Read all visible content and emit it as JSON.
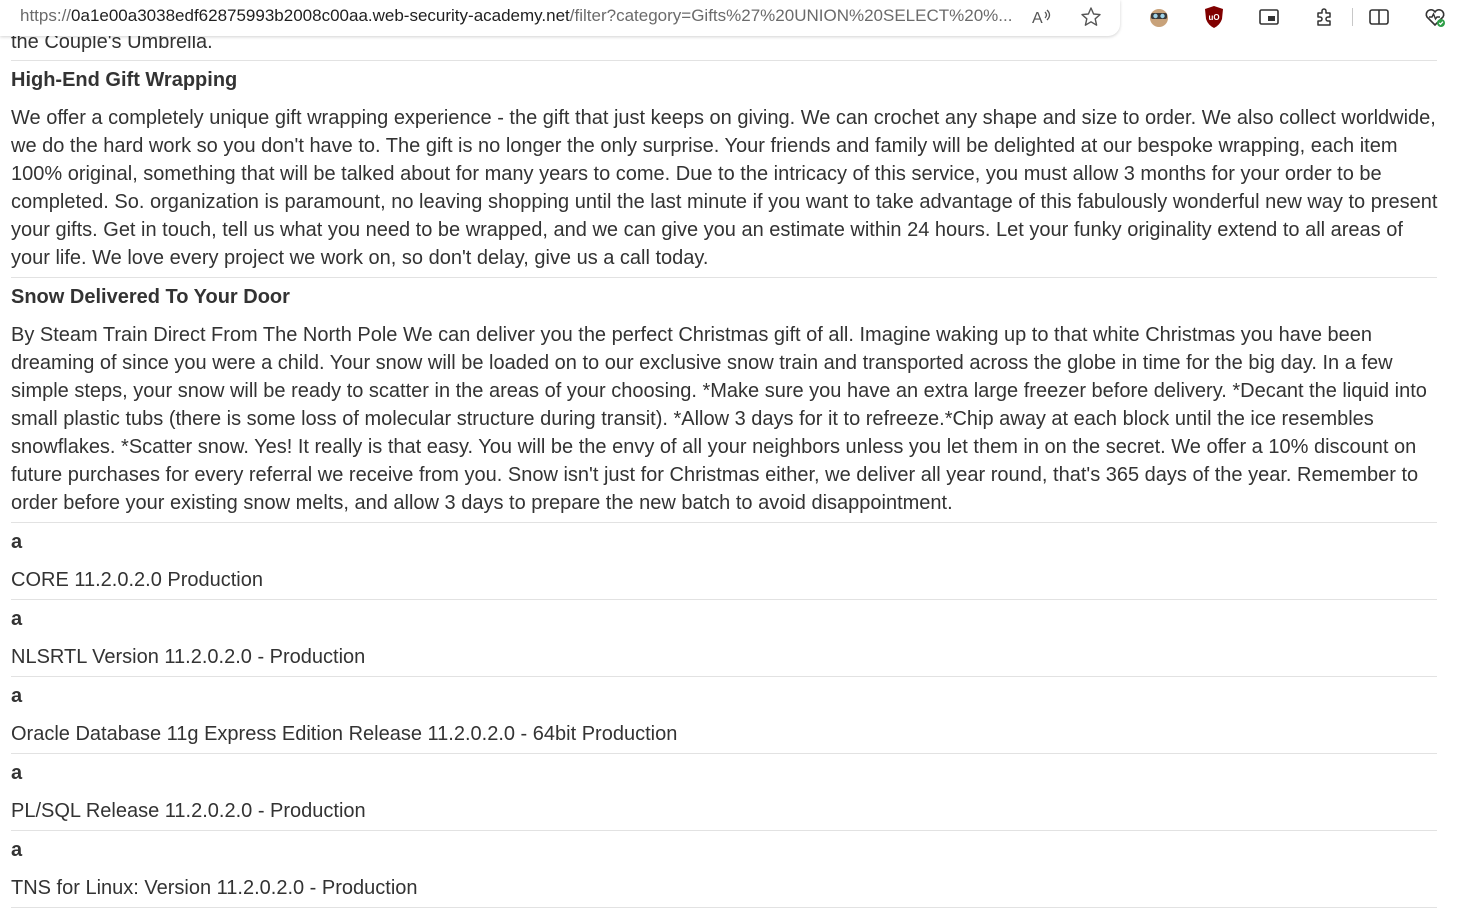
{
  "browser": {
    "url": {
      "prefix": "https://",
      "host": "0a1e00a3038edf62875993b2008c00aa.web-security-academy.net",
      "path": "/filter?category=Gifts%27%20UNION%20SELECT%20%..."
    },
    "icons": [
      "read-aloud-icon",
      "favorite-star-icon",
      "extension-avatar-icon",
      "ublock-icon",
      "picture-in-picture-icon",
      "extensions-puzzle-icon",
      "split-screen-icon",
      "browser-essentials-icon"
    ]
  },
  "page": {
    "clipped_text": "the Couple's Umbrella.",
    "products": [
      {
        "name": "High-End Gift Wrapping",
        "description": "We offer a completely unique gift wrapping experience - the gift that just keeps on giving. We can crochet any shape and size to order. We also collect worldwide, we do the hard work so you don't have to. The gift is no longer the only surprise. Your friends and family will be delighted at our bespoke wrapping, each item 100% original, something that will be talked about for many years to come. Due to the intricacy of this service, you must allow 3 months for your order to be completed. So. organization is paramount, no leaving shopping until the last minute if you want to take advantage of this fabulously wonderful new way to present your gifts. Get in touch, tell us what you need to be wrapped, and we can give you an estimate within 24 hours. Let your funky originality extend to all areas of your life. We love every project we work on, so don't delay, give us a call today."
      },
      {
        "name": "Snow Delivered To Your Door",
        "description": "By Steam Train Direct From The North Pole We can deliver you the perfect Christmas gift of all. Imagine waking up to that white Christmas you have been dreaming of since you were a child. Your snow will be loaded on to our exclusive snow train and transported across the globe in time for the big day. In a few simple steps, your snow will be ready to scatter in the areas of your choosing. *Make sure you have an extra large freezer before delivery. *Decant the liquid into small plastic tubs (there is some loss of molecular structure during transit). *Allow 3 days for it to refreeze.*Chip away at each block until the ice resembles snowflakes. *Scatter snow. Yes! It really is that easy. You will be the envy of all your neighbors unless you let them in on the secret. We offer a 10% discount on future purchases for every referral we receive from you. Snow isn't just for Christmas either, we deliver all year round, that's 365 days of the year. Remember to order before your existing snow melts, and allow 3 days to prepare the new batch to avoid disappointment."
      }
    ],
    "injected_rows": [
      {
        "name": "a",
        "description": "CORE 11.2.0.2.0 Production"
      },
      {
        "name": "a",
        "description": "NLSRTL Version 11.2.0.2.0 - Production"
      },
      {
        "name": "a",
        "description": "Oracle Database 11g Express Edition Release 11.2.0.2.0 - 64bit Production"
      },
      {
        "name": "a",
        "description": "PL/SQL Release 11.2.0.2.0 - Production"
      },
      {
        "name": "a",
        "description": "TNS for Linux: Version 11.2.0.2.0 - Production"
      }
    ]
  }
}
